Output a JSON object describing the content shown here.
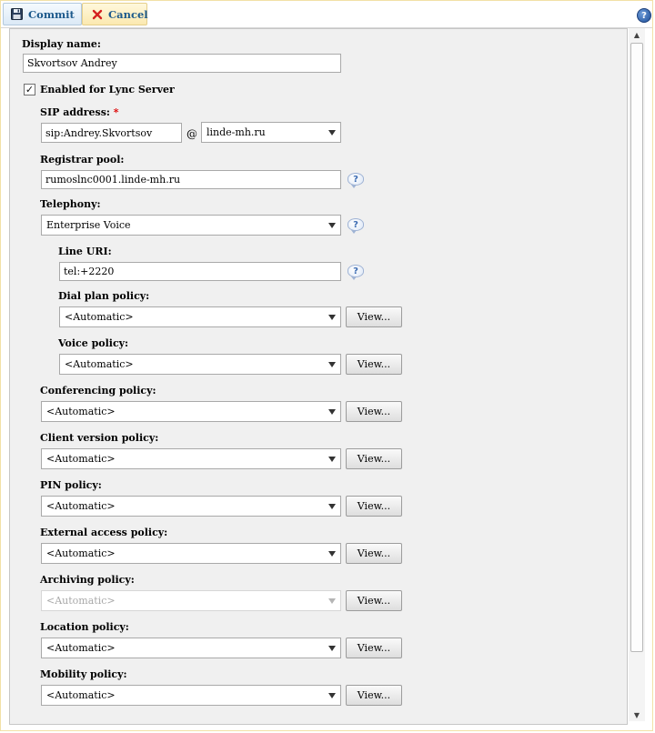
{
  "toolbar": {
    "commit_label": "Commit",
    "cancel_label": "Cancel",
    "help_glyph": "?"
  },
  "colors": {
    "accent": "#1d5a8c",
    "required": "#dd0000",
    "panel_bg": "#f0f0f0"
  },
  "form": {
    "display_name": {
      "label": "Display name:",
      "value": "Skvortsov Andrey"
    },
    "enabled": {
      "label": "Enabled for Lync Server",
      "checked": true,
      "check_glyph": "✓"
    },
    "sip": {
      "label": "SIP address:",
      "required_mark": "*",
      "value": "sip:Andrey.Skvortsov",
      "at": "@",
      "domain": "linde-mh.ru"
    },
    "registrar_pool": {
      "label": "Registrar pool:",
      "value": "rumoslnc0001.linde-mh.ru"
    },
    "telephony": {
      "label": "Telephony:",
      "value": "Enterprise Voice"
    },
    "line_uri": {
      "label": "Line URI:",
      "value": "tel:+2220"
    },
    "dial_plan": {
      "label": "Dial plan policy:",
      "value": "<Automatic>"
    },
    "voice": {
      "label": "Voice policy:",
      "value": "<Automatic>"
    },
    "conferencing": {
      "label": "Conferencing policy:",
      "value": "<Automatic>"
    },
    "client_version": {
      "label": "Client version policy:",
      "value": "<Automatic>"
    },
    "pin": {
      "label": "PIN policy:",
      "value": "<Automatic>"
    },
    "external_access": {
      "label": "External access policy:",
      "value": "<Automatic>"
    },
    "archiving": {
      "label": "Archiving policy:",
      "value": "<Automatic>",
      "disabled": true
    },
    "location": {
      "label": "Location policy:",
      "value": "<Automatic>"
    },
    "mobility": {
      "label": "Mobility policy:",
      "value": "<Automatic>"
    },
    "view_label": "View...",
    "help_glyph": "?"
  },
  "icons": {
    "commit": "save-icon",
    "cancel": "close-icon",
    "help": "help-icon",
    "field_help": "question-bubble-icon",
    "dropdown": "chevron-down-icon"
  },
  "scrollbar": {
    "up_glyph": "▲",
    "down_glyph": "▼"
  }
}
